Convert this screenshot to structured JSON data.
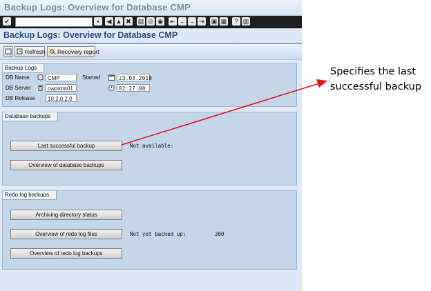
{
  "window": {
    "title": "Backup Logs: Overview for Database CMP"
  },
  "app": {
    "title": "Backup Logs: Overview for Database CMP",
    "toolbar": {
      "refresh_label": "Refresh",
      "recovery_label": "Recovery report"
    }
  },
  "backup_logs": {
    "title": "Backup Logs",
    "db_name_label": "DB Name",
    "db_name_value": "CMP",
    "db_server_label": "DB Server",
    "db_server_value": "cwprdm01",
    "db_release_label": "DB Release",
    "db_release_value": "10.2.0.2.0",
    "started_label": "Started",
    "started_date": "23.03.2010",
    "started_time": "02:27:08"
  },
  "database_backups": {
    "title": "Database backups",
    "last_successful_button": "Last successful backup",
    "last_successful_status": "Not available:",
    "overview_button": "Overview of database backups"
  },
  "redo_log_backups": {
    "title": "Redo log backups",
    "archiving_button": "Archiving directory status",
    "redo_files_button": "Overview of redo log files",
    "redo_files_status": "Not yet backed up:",
    "redo_files_count": "300",
    "redo_backups_button": "Overview of redo log backups"
  },
  "annotation": {
    "text": "Specifies the last successful backup"
  },
  "colors": {
    "accent": "#2c4a82",
    "arrow": "#e0181c",
    "panel": "#c5d6e9"
  }
}
